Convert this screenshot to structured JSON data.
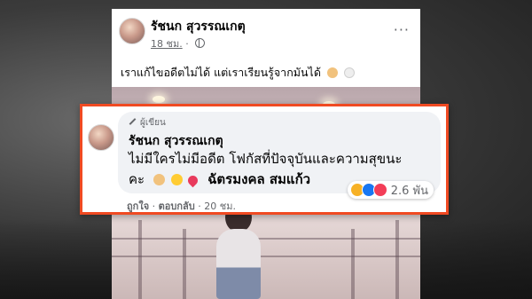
{
  "post": {
    "author_name": "รัชนก สุวรรณเกตุ",
    "time": "18 ชม.",
    "separator": "·",
    "more_label": "···",
    "text": "เราแก้ไขอดีตไม่ได้ แต่เราเรียนรู้จากมันได้"
  },
  "comment": {
    "author_badge": "ผู้เขียน",
    "author_name": "รัชนก สุวรรณเกตุ",
    "line1": "ไม่มีใครไม่มีอดีต โฟกัสที่ปัจจุบันและความสุขนะ",
    "line2": "คะ",
    "tagged_name": "ฉัตรมงคล สมแก้ว",
    "reaction_count": "2.6 พัน",
    "like_label": "ถูกใจ",
    "reply_label": "ตอบกลับ",
    "comment_time": "20 ชม.",
    "dot": "·"
  },
  "icons": {
    "post_reactions_inline": [
      "flexed-biceps",
      "white-circle"
    ],
    "comment_emojis": [
      "flexed-biceps",
      "smiling-face",
      "heart"
    ],
    "comment_reactions": [
      "haha",
      "like",
      "love"
    ]
  },
  "colors": {
    "highlight_border": "#f04a22",
    "bubble": "#f0f2f5",
    "meta_text": "#65676b"
  }
}
